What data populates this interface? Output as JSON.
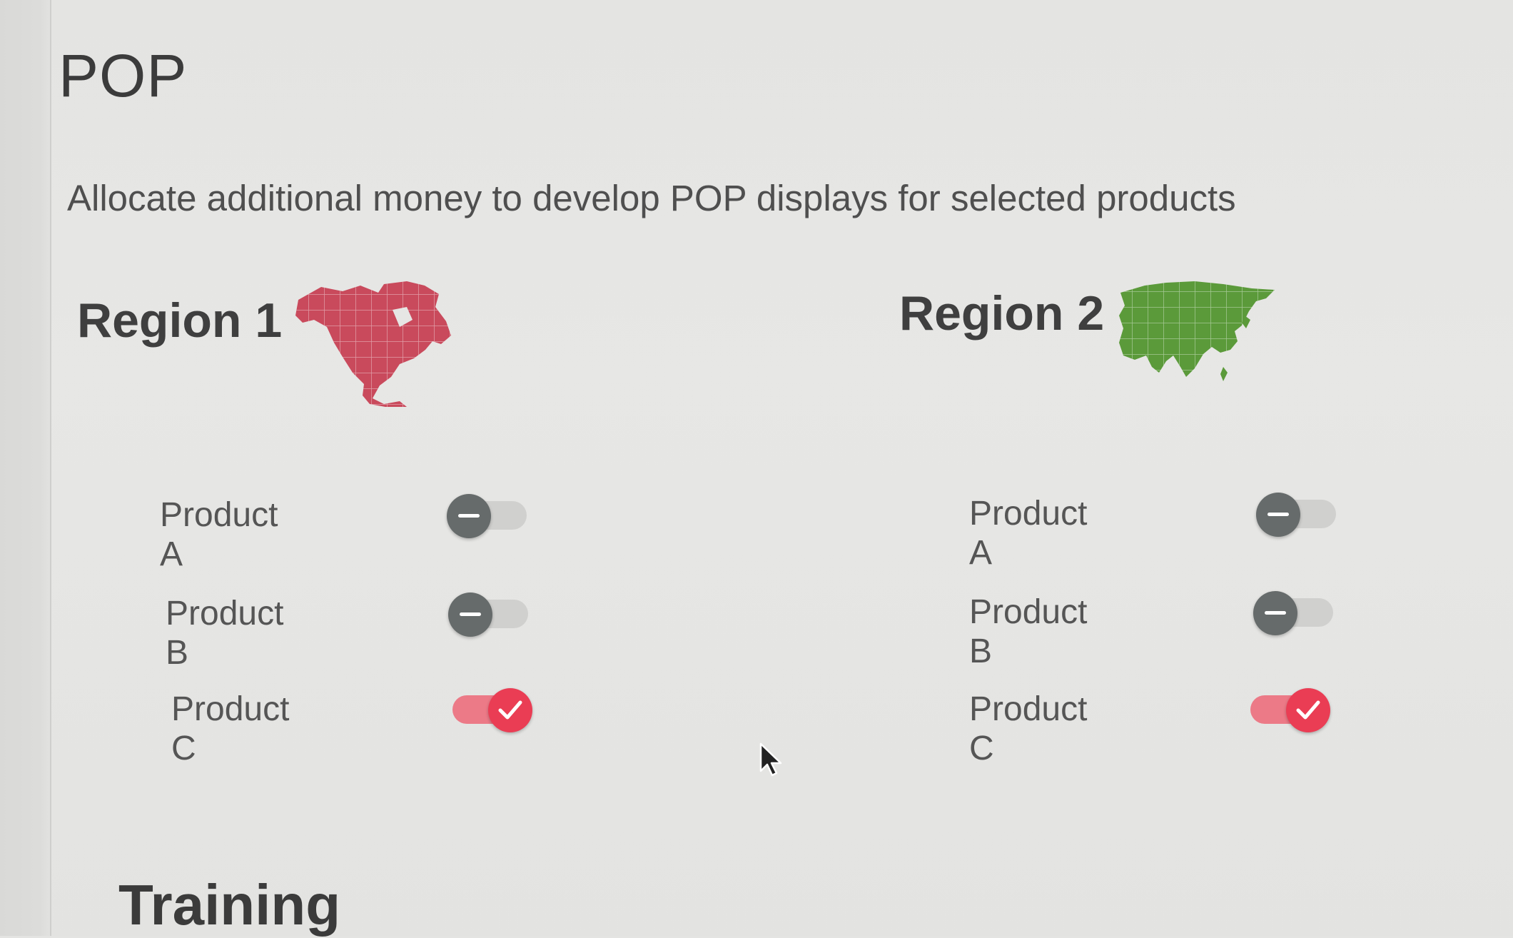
{
  "page": {
    "title": "POP"
  },
  "description": "Allocate additional money to develop POP displays for selected products",
  "regions": [
    {
      "title": "Region 1",
      "map_icon": "north-america-map-icon",
      "map_color": "#c94a5c",
      "products": [
        {
          "label": "Product A",
          "enabled": false
        },
        {
          "label": "Product B",
          "enabled": false
        },
        {
          "label": "Product C",
          "enabled": true
        }
      ]
    },
    {
      "title": "Region 2",
      "map_icon": "asia-map-icon",
      "map_color": "#5b9a3a",
      "products": [
        {
          "label": "Product A",
          "enabled": false
        },
        {
          "label": "Product B",
          "enabled": false
        },
        {
          "label": "Product C",
          "enabled": true
        }
      ]
    }
  ],
  "next_section": {
    "title": "Training"
  },
  "colors": {
    "toggle_on": "#ea3d54",
    "toggle_off": "#666b6b"
  }
}
